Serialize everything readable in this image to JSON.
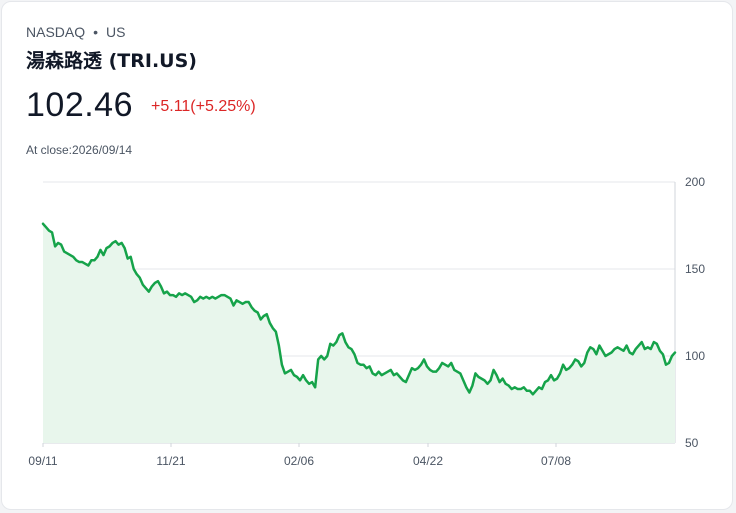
{
  "header": {
    "exchange": "NASDAQ",
    "separator": "•",
    "market": "US",
    "name": "湯森路透 (TRI.US)",
    "price": "102.46",
    "change": "+5.11(+5.25%)",
    "close_label": "At close:2026/09/14"
  },
  "colors": {
    "line": "#16a34a",
    "fill": "#e8f6ec",
    "change": "#dc2626",
    "grid": "#e5e7eb"
  },
  "chart_data": {
    "type": "area",
    "title": "",
    "xlabel": "",
    "ylabel": "",
    "ylim": [
      50,
      200
    ],
    "yticks": [
      200,
      150,
      100,
      50
    ],
    "xtick_labels": [
      "09/11",
      "11/21",
      "02/06",
      "04/22",
      "07/08"
    ],
    "grid": "horizontal",
    "y_axis_position": "right",
    "series": [
      {
        "values": [
          176,
          174,
          172,
          171,
          163,
          165,
          164,
          160,
          159,
          158,
          157,
          155,
          154,
          154,
          153,
          152,
          155,
          155,
          157,
          161,
          158,
          162,
          163,
          165,
          166,
          164,
          165,
          162,
          156,
          157,
          150,
          147,
          145,
          141,
          139,
          137,
          140,
          142,
          143,
          140,
          136,
          137,
          135,
          135,
          134,
          136,
          135,
          136,
          135,
          134,
          131,
          132,
          134,
          133,
          134,
          133,
          134,
          133,
          134,
          135,
          135,
          134,
          133,
          129,
          132,
          131,
          130,
          131,
          131,
          128,
          126,
          125,
          121,
          123,
          124,
          119,
          116,
          114,
          106,
          95,
          90,
          91,
          92,
          89,
          88,
          86,
          89,
          86,
          84,
          85,
          82,
          98,
          100,
          98,
          100,
          107,
          106,
          108,
          112,
          113,
          108,
          105,
          104,
          101,
          96,
          95,
          95,
          93,
          94,
          90,
          89,
          91,
          89,
          90,
          91,
          92,
          89,
          90,
          88,
          86,
          85,
          89,
          93,
          92,
          93,
          95,
          98,
          94,
          92,
          91,
          91,
          93,
          96,
          95,
          94,
          96,
          92,
          91,
          90,
          86,
          82,
          79,
          83,
          90,
          88,
          87,
          86,
          84,
          86,
          92,
          89,
          85,
          87,
          84,
          83,
          81,
          82,
          81,
          81,
          82,
          80,
          80,
          78,
          80,
          82,
          81,
          85,
          86,
          89,
          86,
          87,
          90,
          95,
          92,
          93,
          95,
          98,
          97,
          94,
          96,
          102,
          105,
          104,
          101,
          106,
          103,
          100,
          101,
          102,
          104,
          105,
          104,
          103,
          106,
          102,
          101,
          104,
          106,
          108,
          104,
          105,
          104,
          108,
          107,
          103,
          101,
          95,
          96,
          100,
          102
        ]
      }
    ]
  }
}
